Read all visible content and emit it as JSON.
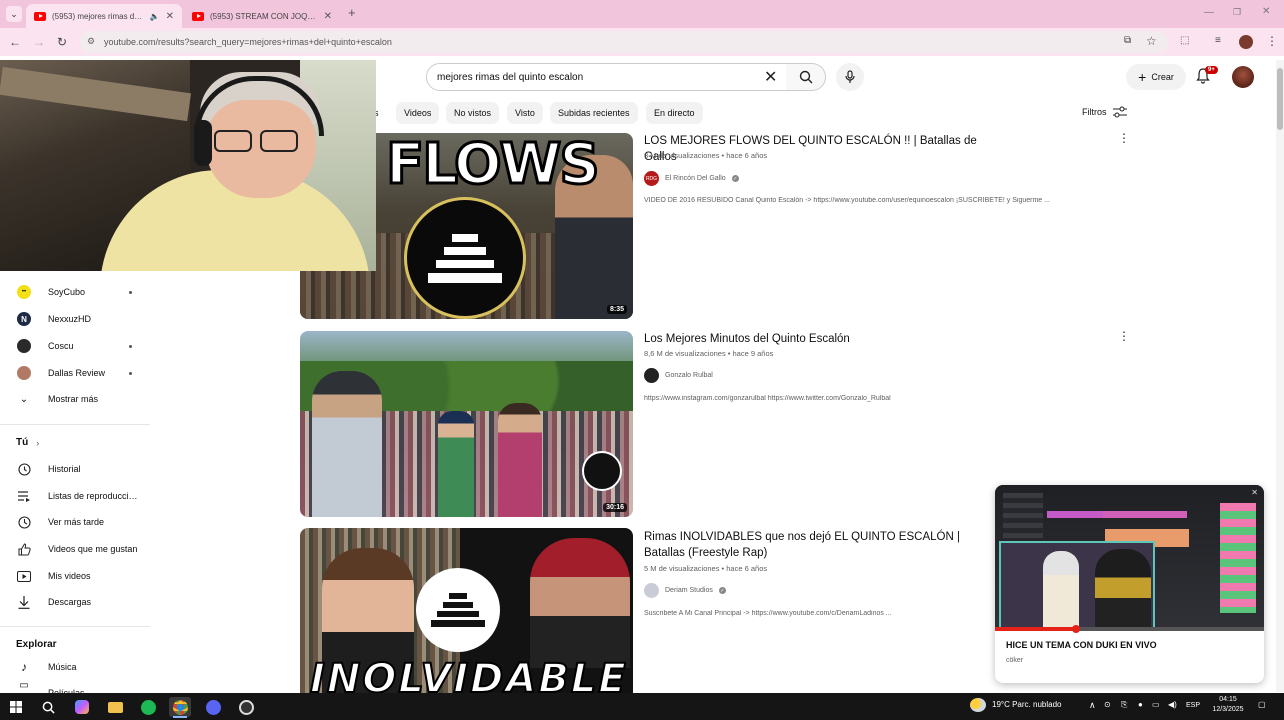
{
  "browser": {
    "tabs": [
      {
        "title": "(5953) mejores rimas del quinto escalon - YouTube",
        "active": true,
        "audio": true
      },
      {
        "title": "(5953) STREAM CON JOQUILES YT",
        "active": false
      }
    ],
    "new_tab_label": "+",
    "url": "youtube.com/results?search_query=mejores+rimas+del+quinto+escalon"
  },
  "youtube": {
    "search_value": "mejores rimas del quinto escalon",
    "create_label": "Crear",
    "notifications_count": "9+",
    "chips": [
      "s",
      "Videos",
      "No vistos",
      "Visto",
      "Subidas recientes",
      "En directo"
    ],
    "filters_label": "Filtros"
  },
  "sidebar": {
    "subscriptions": [
      {
        "label": "SoyCubo",
        "color": "#f3e017",
        "dot": true
      },
      {
        "label": "NexxuzHD",
        "color": "#1f2b44",
        "dot": false
      },
      {
        "label": "Coscu",
        "color": "#2a2a2a",
        "dot": true
      },
      {
        "label": "Dallas Review",
        "color": "#b07a64",
        "dot": true
      }
    ],
    "show_more": "Mostrar más",
    "you_heading": "Tú",
    "you_items": [
      {
        "label": "Historial",
        "icon": "history-icon"
      },
      {
        "label": "Listas de reproducción",
        "icon": "playlists-icon"
      },
      {
        "label": "Ver más tarde",
        "icon": "watch-later-icon"
      },
      {
        "label": "Videos que me gustan",
        "icon": "like-icon"
      },
      {
        "label": "Mis videos",
        "icon": "my-videos-icon"
      },
      {
        "label": "Descargas",
        "icon": "download-icon"
      }
    ],
    "explore_heading": "Explorar",
    "explore_items": [
      {
        "label": "Música",
        "icon": "music-icon"
      },
      {
        "label": "Películas",
        "icon": "movies-icon"
      }
    ]
  },
  "results": [
    {
      "title": "LOS MEJORES FLOWS DEL QUINTO ESCALÓN !! | Batallas de Gallos",
      "meta": "3 M de visualizaciones • hace 6 años",
      "channel": "El Rincón Del Gallo",
      "verified": true,
      "description": "VIDEO DE 2016 RESUBIDO Canal Quinto Escalón -> https://www.youtube.com/user/equinoescalon ¡SUSCRIBETE! y Siguerme ...",
      "duration": "8:35",
      "thumb_text": "FLOWS"
    },
    {
      "title": "Los Mejores Minutos del Quinto Escalón",
      "meta": "8,6 M de visualizaciones • hace 9 años",
      "channel": "Gonzalo Rulbal",
      "verified": false,
      "description": "https://www.instagram.com/gonzarulbal https://www.twitter.com/Gonzalo_Rulbal",
      "duration": "30:16",
      "thumb_text": ""
    },
    {
      "title": "Rimas INOLVIDABLES que nos dejó EL QUINTO ESCALÓN | Batallas (Freestyle Rap)",
      "meta": "5 M de visualizaciones • hace 6 años",
      "channel": "Deriam Studios",
      "verified": true,
      "description": "Suscribete A Mi Canal Principal -> https://www.youtube.com/c/DeriamLadinos ...",
      "duration": "",
      "thumb_text": "INOLVIDABLE"
    }
  ],
  "miniplayer": {
    "title": "HICE UN TEMA CON DUKI EN VIVO",
    "channel": "cöker"
  },
  "taskbar": {
    "weather": "19°C  Parc. nublado",
    "language": "ESP",
    "time": "04:15",
    "date": "12/3/2025"
  }
}
